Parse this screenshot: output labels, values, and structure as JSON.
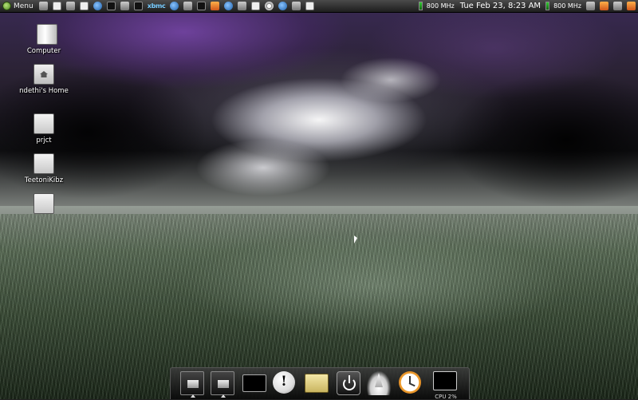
{
  "top_panel": {
    "menu_label": "Menu",
    "xbmc_label": "xbmc",
    "cpu_freq_1": "800 MHz",
    "clock": "Tue Feb 23,  8:23 AM",
    "cpu_freq_2": "800 MHz"
  },
  "desktop": {
    "icons": [
      {
        "label": "Computer"
      },
      {
        "label": "ndethi's Home"
      },
      {
        "label": "prjct"
      },
      {
        "label": "TeetoniKibz"
      }
    ]
  },
  "dock": {
    "cpu_label": "CPU 2%"
  }
}
